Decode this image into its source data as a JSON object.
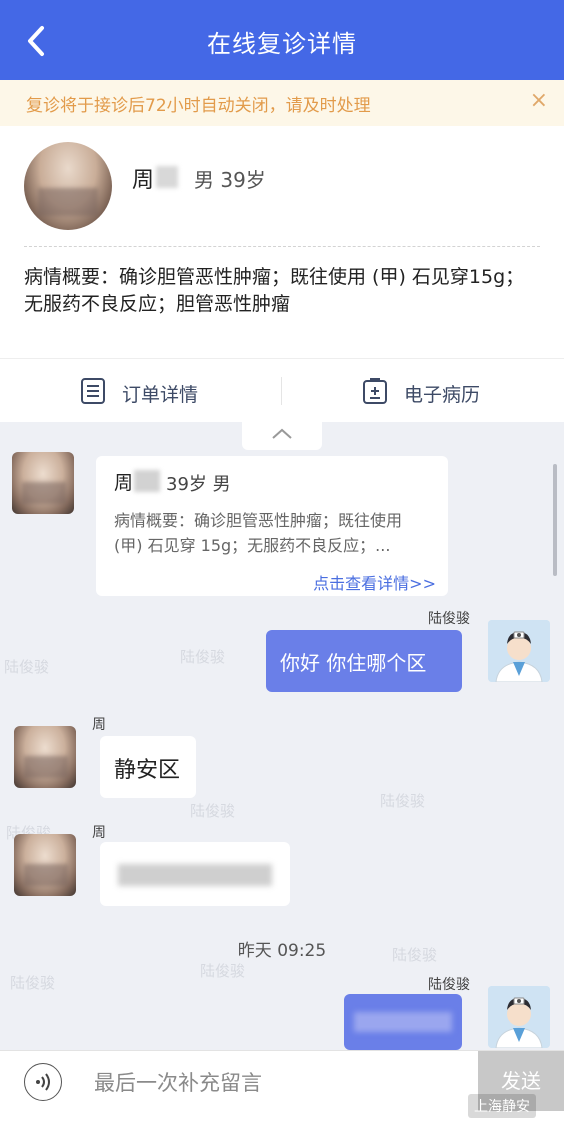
{
  "header": {
    "title": "在线复诊详情"
  },
  "notice": {
    "text": "复诊将于接诊后72小时自动关闭，请及时处理",
    "close": "×"
  },
  "patient": {
    "name": "周",
    "info": "男 39岁",
    "summary": "病情概要：确诊胆管恶性肿瘤；既往使用 (甲) 石见穿15g；无服药不良反应；胆管恶性肿瘤"
  },
  "tabs": [
    {
      "label": "订单详情"
    },
    {
      "label": "电子病历"
    }
  ],
  "chat": {
    "card": {
      "name": "周",
      "age": "39岁 男",
      "summary": "病情概要：确诊胆管恶性肿瘤；既往使用 (甲) 石见穿 15g；无服药不良反应；...",
      "link": "点击查看详情>>"
    },
    "doctor_name": "陆俊骏",
    "patient_name": "周",
    "messages": [
      {
        "from": "doctor",
        "text": "你好 你住哪个区"
      },
      {
        "from": "patient",
        "text": "静安区"
      },
      {
        "from": "patient",
        "text": ""
      },
      {
        "from": "doctor",
        "text": ""
      }
    ],
    "timestamp": "昨天 09:25",
    "watermark": "陆俊骏"
  },
  "input": {
    "placeholder": "最后一次补充留言",
    "send_label": "发送"
  },
  "account_watermark": "上海静安"
}
